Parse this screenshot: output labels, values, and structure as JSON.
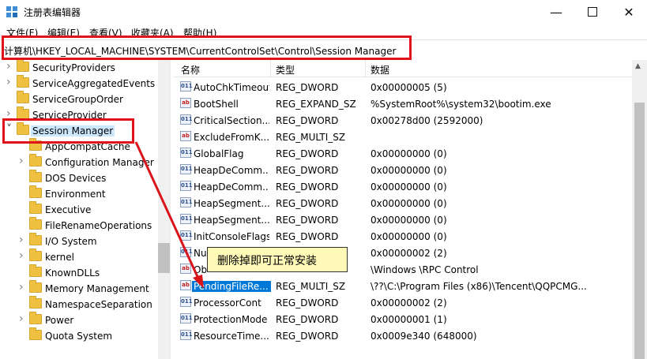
{
  "window": {
    "title": "注册表编辑器",
    "minimize_icon": "minimize-icon",
    "maximize_icon": "maximize-icon",
    "close_icon": "close-icon"
  },
  "menu": [
    "文件(F)",
    "编辑(E)",
    "查看(V)",
    "收藏夹(A)",
    "帮助(H)"
  ],
  "address": "计算机\\HKEY_LOCAL_MACHINE\\SYSTEM\\CurrentControlSet\\Control\\Session Manager",
  "tree": [
    {
      "label": "SecurityProviders",
      "level": 0,
      "expandable": true
    },
    {
      "label": "ServiceAggregatedEvents",
      "level": 0,
      "expandable": true
    },
    {
      "label": "ServiceGroupOrder",
      "level": 0,
      "expandable": false
    },
    {
      "label": "ServiceProvider",
      "level": 0,
      "expandable": true
    },
    {
      "label": "Session Manager",
      "level": 0,
      "expandable": true,
      "expanded": true,
      "selected": true
    },
    {
      "label": "AppCompatCache",
      "level": 1,
      "expandable": false
    },
    {
      "label": "Configuration Manager",
      "level": 1,
      "expandable": true
    },
    {
      "label": "DOS Devices",
      "level": 1,
      "expandable": false
    },
    {
      "label": "Environment",
      "level": 1,
      "expandable": false
    },
    {
      "label": "Executive",
      "level": 1,
      "expandable": false
    },
    {
      "label": "FileRenameOperations",
      "level": 1,
      "expandable": false
    },
    {
      "label": "I/O System",
      "level": 1,
      "expandable": true
    },
    {
      "label": "kernel",
      "level": 1,
      "expandable": true
    },
    {
      "label": "KnownDLLs",
      "level": 1,
      "expandable": false
    },
    {
      "label": "Memory Management",
      "level": 1,
      "expandable": true
    },
    {
      "label": "NamespaceSeparation",
      "level": 1,
      "expandable": false
    },
    {
      "label": "Power",
      "level": 1,
      "expandable": true
    },
    {
      "label": "Quota System",
      "level": 1,
      "expandable": false
    }
  ],
  "columns": {
    "name": "名称",
    "type": "类型",
    "data": "数据"
  },
  "values": [
    {
      "icon": "binary-value-icon",
      "name": "AutoChkTimeout",
      "type": "REG_DWORD",
      "data": "0x00000005 (5)"
    },
    {
      "icon": "string-value-icon",
      "name": "BootShell",
      "type": "REG_EXPAND_SZ",
      "data": "%SystemRoot%\\system32\\bootim.exe"
    },
    {
      "icon": "binary-value-icon",
      "name": "CriticalSection...",
      "type": "REG_DWORD",
      "data": "0x00278d00 (2592000)"
    },
    {
      "icon": "string-value-icon",
      "name": "ExcludeFromK...",
      "type": "REG_MULTI_SZ",
      "data": ""
    },
    {
      "icon": "binary-value-icon",
      "name": "GlobalFlag",
      "type": "REG_DWORD",
      "data": "0x00000000 (0)"
    },
    {
      "icon": "binary-value-icon",
      "name": "HeapDeComm...",
      "type": "REG_DWORD",
      "data": "0x00000000 (0)"
    },
    {
      "icon": "binary-value-icon",
      "name": "HeapDeComm...",
      "type": "REG_DWORD",
      "data": "0x00000000 (0)"
    },
    {
      "icon": "binary-value-icon",
      "name": "HeapSegment...",
      "type": "REG_DWORD",
      "data": "0x00000000 (0)"
    },
    {
      "icon": "binary-value-icon",
      "name": "HeapSegment...",
      "type": "REG_DWORD",
      "data": "0x00000000 (0)"
    },
    {
      "icon": "binary-value-icon",
      "name": "InitConsoleFlags",
      "type": "REG_DWORD",
      "data": "0x00000000 (0)"
    },
    {
      "icon": "binary-value-icon",
      "name": "Nu",
      "type": "",
      "data": "0x00000002 (2)"
    },
    {
      "icon": "string-value-icon",
      "name": "Ob",
      "type": "",
      "data": "\\Windows \\RPC Control"
    },
    {
      "icon": "string-value-icon",
      "name": "PendingFileRe...",
      "type": "REG_MULTI_SZ",
      "data": "\\??\\C:\\Program Files (x86)\\Tencent\\QQPCMG...",
      "selected": true
    },
    {
      "icon": "binary-value-icon",
      "name": "ProcessorCont",
      "type": "REG_DWORD",
      "data": "0x00000002 (2)"
    },
    {
      "icon": "binary-value-icon",
      "name": "ProtectionMode",
      "type": "REG_DWORD",
      "data": "0x00000001 (1)"
    },
    {
      "icon": "binary-value-icon",
      "name": "ResourceTime...",
      "type": "REG_DWORD",
      "data": "0x0009e340 (648000)"
    }
  ],
  "callout": "删除掉即可正常安装",
  "colors": {
    "highlight_border": "#e0131b",
    "arrow": "#d9141b",
    "callout_bg": "#fff9b8",
    "selection": "#0078d7"
  }
}
